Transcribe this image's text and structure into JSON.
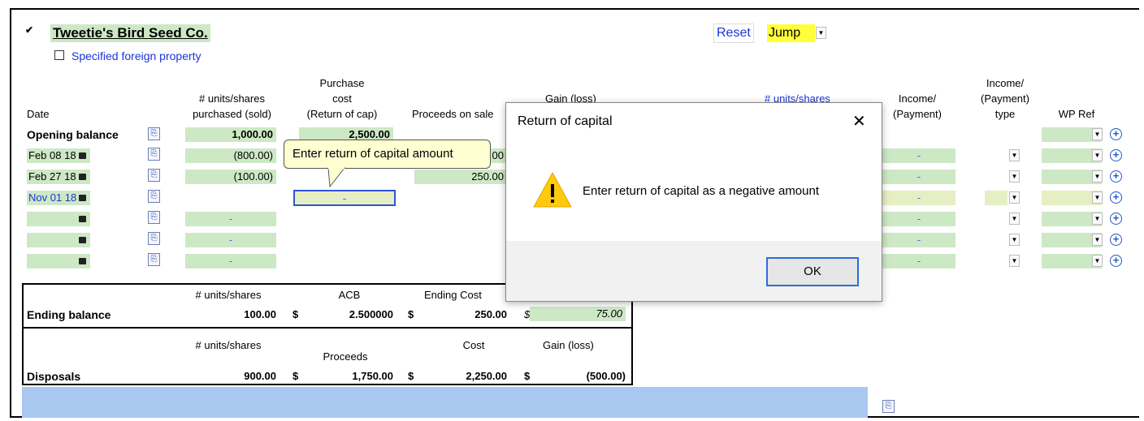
{
  "header": {
    "title": "Tweetie's Bird Seed Co.",
    "foreign_property": "Specified foreign property",
    "reset": "Reset",
    "jump": "Jump"
  },
  "columns": {
    "date": "Date",
    "units_l1": "# units/shares",
    "units_l2": "purchased (sold)",
    "purchase_l1": "Purchase",
    "purchase_l2": "cost",
    "purchase_l3": "(Return of cap)",
    "proceeds": "Proceeds on sale",
    "gain": "Gain (loss)",
    "units_link": "# units/shares",
    "income_l1": "Income/",
    "income_l2": "(Payment)",
    "type_l1": "Income/",
    "type_l2": "(Payment)",
    "type_l3": "type",
    "wpref": "WP Ref"
  },
  "opening": {
    "label": "Opening balance",
    "units": "1,000.00",
    "cost": "2,500.00"
  },
  "rows": [
    {
      "date": "Feb 08 18",
      "units": "(800.00)",
      "proceeds": "00"
    },
    {
      "date": "Feb 27 18",
      "units": "(100.00)",
      "proceeds": "250.00"
    },
    {
      "date": "Nov 01 18",
      "cost": "-"
    },
    {
      "units": "-"
    },
    {
      "units": "-"
    },
    {
      "units": "-"
    }
  ],
  "dash": "-",
  "ending": {
    "h_units": "# units/shares",
    "h_acb": "ACB",
    "h_cost": "Ending Cost",
    "label": "Ending balance",
    "units": "100.00",
    "cur": "$",
    "acb": "2.500000",
    "cost": "250.00",
    "gain": "75.00"
  },
  "disposals": {
    "h_units": "# units/shares",
    "h_proceeds": "Proceeds",
    "h_cost": "Cost",
    "h_gain": "Gain (loss)",
    "label": "Disposals",
    "units": "900.00",
    "proceeds": "1,750.00",
    "cost": "2,250.00",
    "gain": "(500.00)"
  },
  "tooltip": "Enter return of capital amount",
  "dialog": {
    "title": "Return of capital",
    "message": "Enter return of capital as a negative amount",
    "ok": "OK",
    "close": "✕"
  },
  "colors": {
    "field": "#cde8c5",
    "link": "#1a35d6",
    "summary_bar": "#a9c8ef"
  }
}
